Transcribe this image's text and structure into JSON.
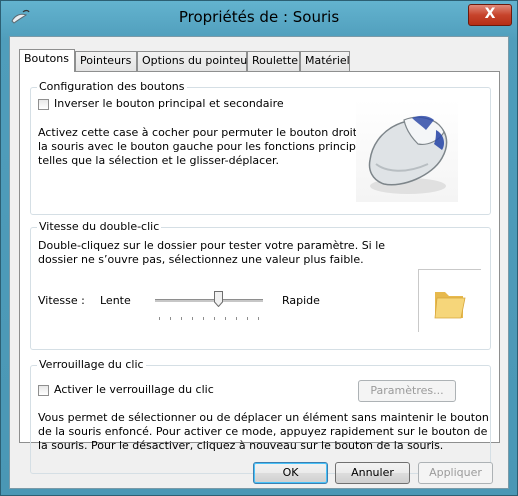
{
  "window": {
    "title": "Propriétés de : Souris",
    "close_label": "X"
  },
  "tabs": [
    {
      "label": "Boutons",
      "active": true
    },
    {
      "label": "Pointeurs",
      "active": false
    },
    {
      "label": "Options du pointeur",
      "active": false
    },
    {
      "label": "Roulette",
      "active": false
    },
    {
      "label": "Matériel",
      "active": false
    }
  ],
  "button_config": {
    "legend": "Configuration des boutons",
    "checkbox_label": "Inverser le bouton principal et secondaire",
    "checked": false,
    "description": [
      "Activez cette case à cocher pour permuter le bouton droit de",
      "la souris avec le bouton gauche pour les fonctions principales",
      "telles que la sélection et le glisser-déplacer."
    ]
  },
  "double_click": {
    "legend": "Vitesse du double-clic",
    "description": [
      "Double-cliquez sur le dossier pour tester votre paramètre. Si le",
      "dossier ne s’ouvre pas, sélectionnez une valeur plus faible."
    ],
    "speed_label": "Vitesse :",
    "slow_label": "Lente",
    "fast_label": "Rapide",
    "slider_value": 0.6
  },
  "click_lock": {
    "legend": "Verrouillage du clic",
    "checkbox_label": "Activer le verrouillage du clic",
    "checked": false,
    "settings_button": "Paramètres...",
    "description": [
      "Vous permet de sélectionner ou de déplacer un élément sans maintenir le bouton",
      "de la souris enfoncé. Pour activer ce mode, appuyez rapidement sur le bouton de",
      "la souris. Pour le désactiver, cliquez à nouveau sur le bouton de la souris."
    ]
  },
  "footer": {
    "ok": "OK",
    "cancel": "Annuler",
    "apply": "Appliquer"
  }
}
